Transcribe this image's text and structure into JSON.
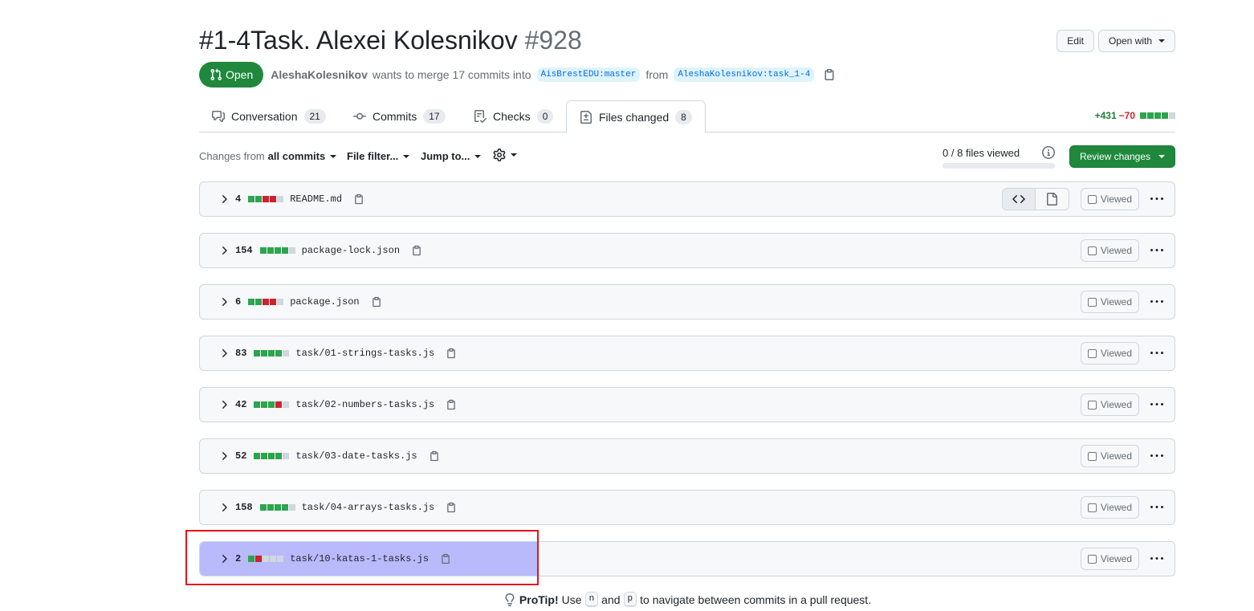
{
  "header": {
    "title": "#1-4Task. Alexei Kolesnikov",
    "number": "#928",
    "edit_label": "Edit",
    "open_with_label": "Open with"
  },
  "meta": {
    "state": "Open",
    "author": "AleshaKolesnikov",
    "action_text": "wants to merge 17 commits into",
    "base_branch": "AisBrestEDU:master",
    "from_text": "from",
    "head_branch": "AleshaKolesnikov:task_1-4"
  },
  "tabs": [
    {
      "label": "Conversation",
      "count": "21",
      "icon": "comment-discussion-icon"
    },
    {
      "label": "Commits",
      "count": "17",
      "icon": "git-commit-icon"
    },
    {
      "label": "Checks",
      "count": "0",
      "icon": "checklist-icon"
    },
    {
      "label": "Files changed",
      "count": "8",
      "icon": "file-diff-icon",
      "active": true
    }
  ],
  "diffstat": {
    "additions": "+431",
    "deletions": "−70",
    "blocks": [
      "added",
      "added",
      "added",
      "added",
      "neutral"
    ]
  },
  "toolbar": {
    "changes_from_prefix": "Changes from",
    "changes_from_value": "all commits",
    "file_filter": "File filter...",
    "jump_to": "Jump to...",
    "files_viewed": "0 / 8 files viewed",
    "files_viewed_fraction": 0,
    "review_changes": "Review changes"
  },
  "files": [
    {
      "changes": "4",
      "name": "README.md",
      "viewed_label": "Viewed",
      "blocks": [
        "added",
        "added",
        "deleted",
        "deleted",
        "neutral"
      ]
    },
    {
      "changes": "154",
      "name": "package-lock.json",
      "viewed_label": "Viewed",
      "blocks": [
        "added",
        "added",
        "added",
        "added",
        "neutral"
      ]
    },
    {
      "changes": "6",
      "name": "package.json",
      "viewed_label": "Viewed",
      "blocks": [
        "added",
        "added",
        "deleted",
        "deleted",
        "neutral"
      ]
    },
    {
      "changes": "83",
      "name": "task/01-strings-tasks.js",
      "viewed_label": "Viewed",
      "blocks": [
        "added",
        "added",
        "added",
        "added",
        "neutral"
      ]
    },
    {
      "changes": "42",
      "name": "task/02-numbers-tasks.js",
      "viewed_label": "Viewed",
      "blocks": [
        "added",
        "added",
        "added",
        "deleted",
        "neutral"
      ]
    },
    {
      "changes": "52",
      "name": "task/03-date-tasks.js",
      "viewed_label": "Viewed",
      "blocks": [
        "added",
        "added",
        "added",
        "added",
        "neutral"
      ]
    },
    {
      "changes": "158",
      "name": "task/04-arrays-tasks.js",
      "viewed_label": "Viewed",
      "blocks": [
        "added",
        "added",
        "added",
        "added",
        "neutral"
      ]
    },
    {
      "changes": "2",
      "name": "task/10-katas-1-tasks.js",
      "viewed_label": "Viewed",
      "blocks": [
        "added",
        "deleted",
        "neutral",
        "neutral",
        "neutral"
      ]
    }
  ],
  "protip": {
    "label": "ProTip!",
    "text_before": "Use",
    "key1": "n",
    "and_text": "and",
    "key2": "p",
    "text_after": "to navigate between commits in a pull request."
  },
  "colors": {
    "added": "#2da44e",
    "deleted": "#cf222e",
    "neutral": "#d0d7de",
    "open_badge": "#1f883d",
    "highlight_border": "#e5121b"
  }
}
